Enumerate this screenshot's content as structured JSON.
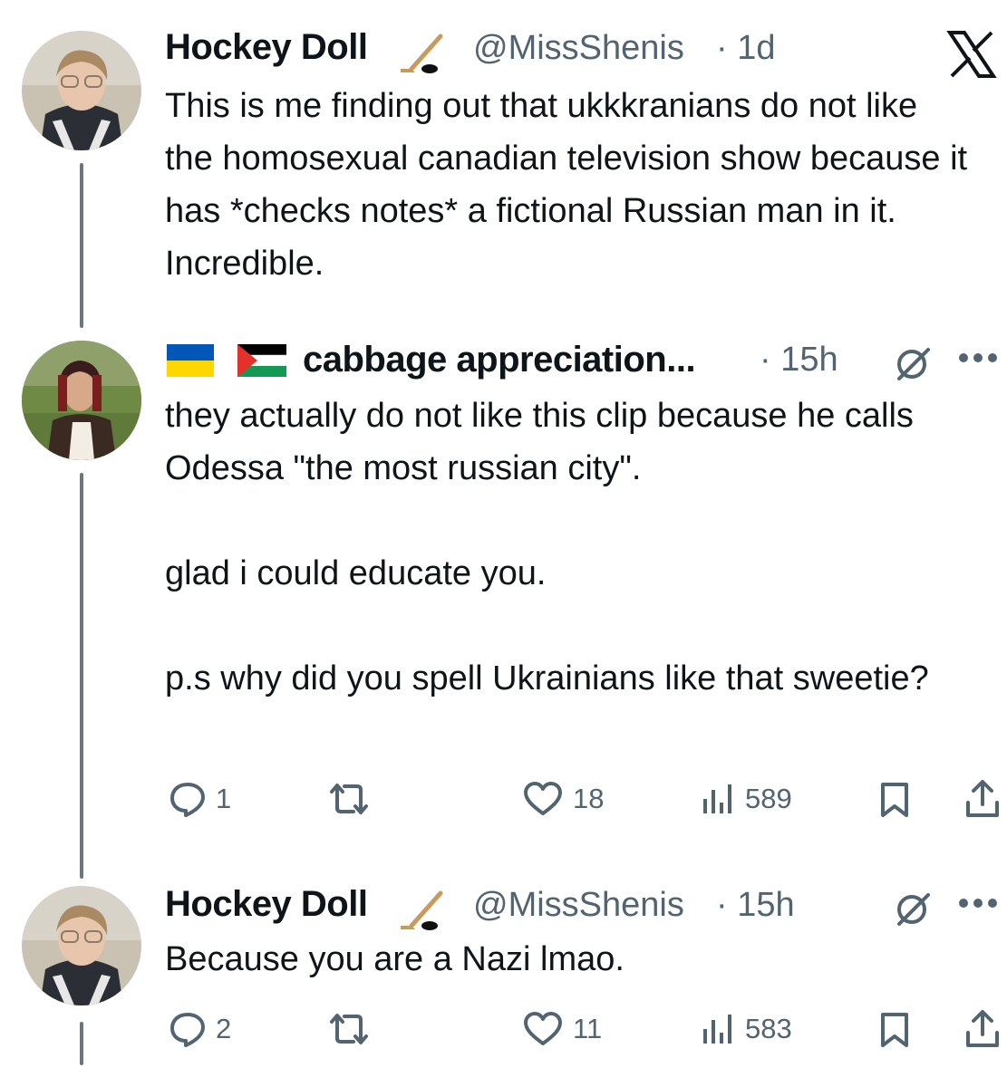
{
  "tweets": [
    {
      "name": "Hockey Doll",
      "handle": "@MissShenis",
      "time": "· 1d",
      "text": "This is me finding out that ukkkranians do not like the homosexual canadian television show because it has *checks notes* a fictional Russian man in it. Incredible.",
      "icons": {
        "name_emoji": "hockey-stick-icon",
        "corner": "x-logo-icon"
      }
    },
    {
      "name": "cabbage appreciation...",
      "time": "· 15h",
      "flags": [
        "ukraine-flag-icon",
        "palestine-flag-icon"
      ],
      "text": "they actually do not like this clip because he calls Odessa \"the most russian city\".\n\nglad i could educate you.\n\np.s why did you spell Ukrainians like that sweetie?",
      "actions": {
        "replies": "1",
        "likes": "18",
        "views": "589"
      }
    },
    {
      "name": "Hockey Doll",
      "handle": "@MissShenis",
      "time": "· 15h",
      "text": "Because you are a Nazi lmao.",
      "actions": {
        "replies": "2",
        "likes": "11",
        "views": "583"
      }
    }
  ],
  "colors": {
    "text": "#0f1419",
    "secondary": "#536471",
    "thread_line": "#6b7680",
    "ukraine_blue": "#0057b7",
    "ukraine_yellow": "#ffd700"
  }
}
